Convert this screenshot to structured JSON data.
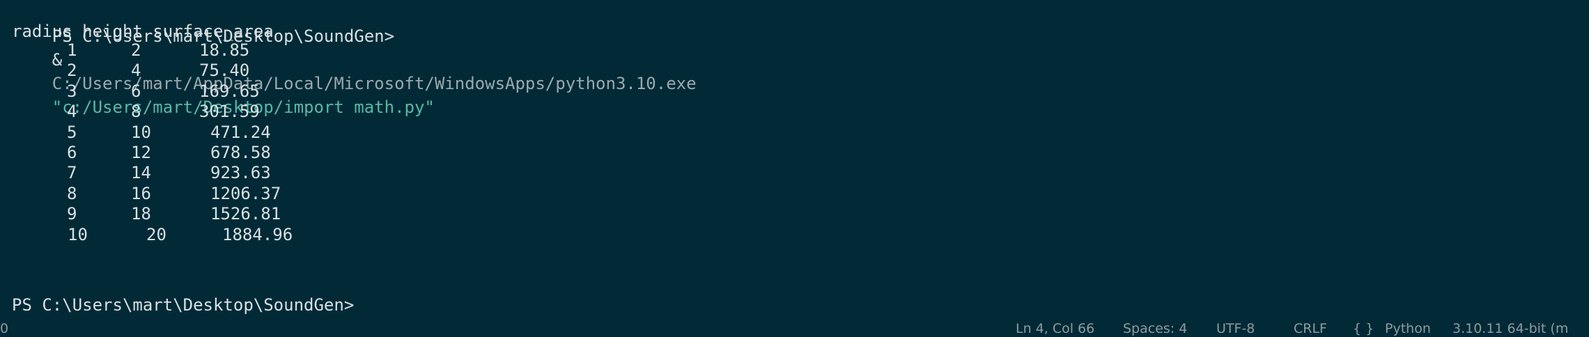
{
  "terminal": {
    "command": {
      "prompt": "PS C:\\Users\\mart\\Desktop\\SoundGen>",
      "operator": "&",
      "executable": "C:/Users/mart/AppData/Local/Microsoft/WindowsApps/python3.10.exe",
      "script": "\"c:/Users/mart/Desktop/import math.py\""
    },
    "header": "radius height surface_area",
    "rows": [
      {
        "radius": "1",
        "height": "2",
        "surface_area": "18.85"
      },
      {
        "radius": "2",
        "height": "4",
        "surface_area": "75.40"
      },
      {
        "radius": "3",
        "height": "6",
        "surface_area": "169.65"
      },
      {
        "radius": "4",
        "height": "8",
        "surface_area": "301.59"
      },
      {
        "radius": "5",
        "height": "10",
        "surface_area": "471.24"
      },
      {
        "radius": "6",
        "height": "12",
        "surface_area": "678.58"
      },
      {
        "radius": "7",
        "height": "14",
        "surface_area": "923.63"
      },
      {
        "radius": "8",
        "height": "16",
        "surface_area": "1206.37"
      },
      {
        "radius": "9",
        "height": "18",
        "surface_area": "1526.81"
      },
      {
        "radius": "10",
        "height": "20",
        "surface_area": "1884.96"
      }
    ],
    "final_prompt": "PS C:\\Users\\mart\\Desktop\\SoundGen>"
  },
  "statusbar": {
    "left_count": "0",
    "position": "Ln 4, Col 66",
    "spaces": "Spaces: 4",
    "encoding": "UTF-8",
    "line_ending": "CRLF",
    "language_icon": "braces-icon",
    "language": "Python",
    "interpreter": "3.10.11 64-bit (m"
  },
  "colors": {
    "background": "#022a36",
    "text": "#d7e0e3",
    "path": "#9aa9af",
    "string": "#59b8a6",
    "status_text": "#8d9ca2"
  }
}
